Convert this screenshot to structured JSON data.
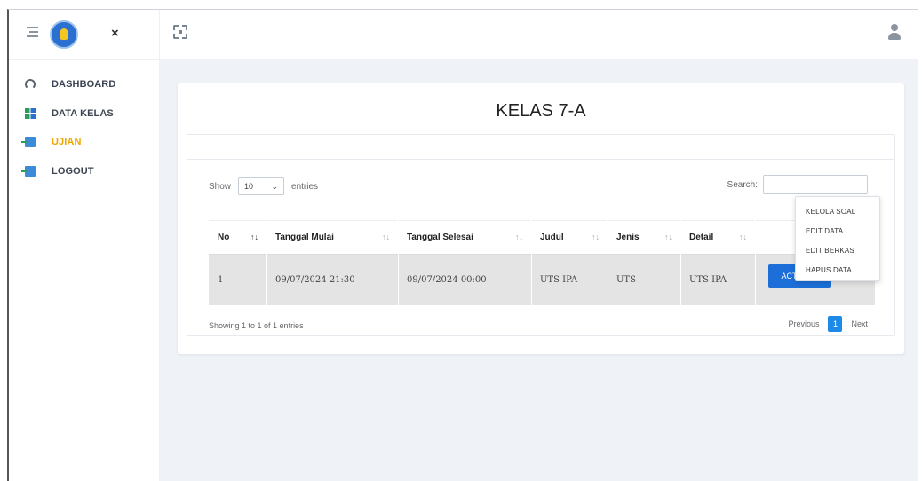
{
  "header": {
    "logo": "tut-wuri-handayani-logo",
    "close_label": "×",
    "icons": [
      "menu-icon",
      "close-icon",
      "fullscreen-icon",
      "user-icon"
    ]
  },
  "sidebar": {
    "items": [
      {
        "label": "DASHBOARD",
        "icon": "dashboard-gauge-icon",
        "active": false
      },
      {
        "label": "DATA KELAS",
        "icon": "grid-icon",
        "active": false
      },
      {
        "label": "UJIAN",
        "icon": "door-icon",
        "active": true
      },
      {
        "label": "LOGOUT",
        "icon": "door-icon",
        "active": false
      }
    ],
    "active_color": "#f0a500"
  },
  "main": {
    "title": "KELAS 7-A",
    "length": {
      "show": "Show",
      "value": "10",
      "entries": "entries"
    },
    "search": {
      "label": "Search:",
      "value": ""
    },
    "table": {
      "columns": [
        "No",
        "Tanggal Mulai",
        "Tanggal Selesai",
        "Judul",
        "Jenis",
        "Detail",
        ""
      ],
      "rows": [
        {
          "no": "1",
          "tanggal_mulai": "09/07/2024 21:30",
          "tanggal_selesai": "09/07/2024 00:00",
          "judul": "UTS IPA",
          "jenis": "UTS",
          "detail": "UTS IPA"
        }
      ]
    },
    "action_label": "ACTION ▾",
    "dropdown_items": [
      "KELOLA SOAL",
      "EDIT DATA",
      "EDIT BERKAS",
      "HAPUS DATA"
    ],
    "info": "Showing 1 to 1 of 1 entries",
    "pager": {
      "previous": "Previous",
      "current": "1",
      "next": "Next"
    },
    "accent_color": "#1c6fd9"
  }
}
